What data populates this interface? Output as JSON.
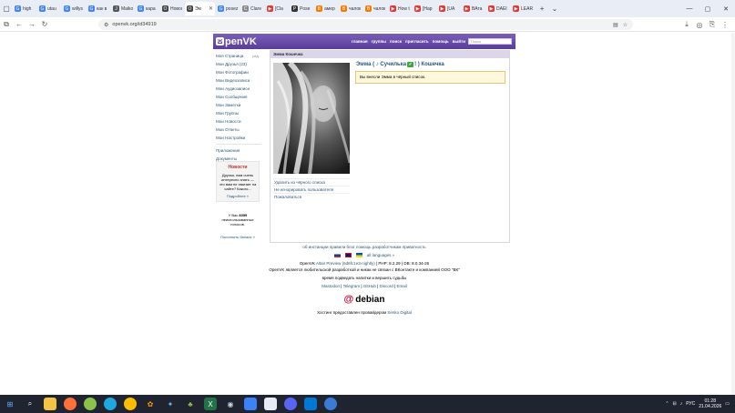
{
  "browser": {
    "tabs": [
      {
        "title": "high",
        "color": "#4285f4",
        "glyph": "G"
      },
      {
        "title": "utau",
        "color": "#4285f4",
        "glyph": "G"
      },
      {
        "title": "willys",
        "color": "#4285f4",
        "glyph": "G"
      },
      {
        "title": "как в",
        "color": "#4285f4",
        "glyph": "G"
      },
      {
        "title": "Maiko",
        "color": "#555555",
        "glyph": "J"
      },
      {
        "title": "кара",
        "color": "#4285f4",
        "glyph": "G"
      },
      {
        "title": "Новос",
        "color": "#444444",
        "glyph": "O"
      },
      {
        "title": "Эм",
        "color": "#444444",
        "glyph": "O",
        "active": true
      },
      {
        "title": "posez",
        "color": "#4285f4",
        "glyph": "G"
      },
      {
        "title": "Clare",
        "color": "#888888",
        "glyph": "C"
      },
      {
        "title": "[Cla",
        "color": "#e53935",
        "glyph": "▶"
      },
      {
        "title": "Pose",
        "color": "#333333",
        "glyph": "P"
      },
      {
        "title": "амер",
        "color": "#f57c00",
        "glyph": "B"
      },
      {
        "title": "чалов",
        "color": "#f57c00",
        "glyph": "B"
      },
      {
        "title": "чалов",
        "color": "#f57c00",
        "glyph": "B"
      },
      {
        "title": "How t",
        "color": "#e53935",
        "glyph": "▶"
      },
      {
        "title": "[Нар",
        "color": "#e53935",
        "glyph": "▶"
      },
      {
        "title": "[UA",
        "color": "#e53935",
        "glyph": "▶"
      },
      {
        "title": "ВАта",
        "color": "#e53935",
        "glyph": "▶"
      },
      {
        "title": "DAEI",
        "color": "#e53935",
        "glyph": "▶"
      },
      {
        "title": "LEAR",
        "color": "#e53935",
        "glyph": "▶"
      }
    ],
    "url": "openvk.org/id34919"
  },
  "ovk": {
    "logo": "penVK",
    "nav": [
      "главная",
      "группы",
      "поиск",
      "пригласить",
      "помощь",
      "выйти"
    ],
    "search_placeholder": "Поиск",
    "sidebar": [
      {
        "label": "Моя Страница",
        "edit": "ред."
      },
      {
        "label": "Мои Друзья (23)"
      },
      {
        "label": "Мои Фотографии"
      },
      {
        "label": "Мои Видеозаписи"
      },
      {
        "label": "Мои Аудиозаписи"
      },
      {
        "label": "Мои Сообщения"
      },
      {
        "label": "Мои Заметки"
      },
      {
        "label": "Мои Группы"
      },
      {
        "label": "Мои Новости"
      },
      {
        "label": "Мои Ответы"
      },
      {
        "label": "Мои Настройки"
      }
    ],
    "sidebar2": [
      "Приложения",
      "Документы"
    ],
    "news": {
      "title": "Новости",
      "text": "Друзья, нам очень интересно знать — что вам не хватает на сайте? Какого...",
      "more": "Подробнее »"
    },
    "balance": {
      "prefix": "У Вас",
      "amount": "8359",
      "suffix": "неиспользованных голосов.",
      "topup": "Пополнить баланс »"
    },
    "profile": {
      "header": "Эмма Кошечка",
      "name": "Эмма ( ♪ Сучилька",
      "name_check": "✓",
      "name_tail": "! ) Кошечка",
      "note": "Вы внесли Эмма в чёрный список.",
      "links": [
        "Удалить из чёрного списка",
        "Не игнорировать пользователя",
        "Пожаловаться"
      ]
    },
    "footer": {
      "links": [
        "об инстанции",
        "правила",
        "блог",
        "помощь",
        "разработчикам",
        "приватность"
      ],
      "all_languages": "all languages »",
      "version_prefix": "OpenVK",
      "version_link": "Altair Preview (6d6fc1e3-nightly)",
      "version_suffix": "| PHP: 8.2.29 | DB: 8.0.34-26",
      "disclaimer": "OpenVK является любительской разработкой и никак не связан с ВКонтакте и компанией ООО \"ВК\"",
      "motto": "время подведать напитки и вершить судьбы",
      "socials": [
        "Mastodon",
        "Telegram",
        "GitHub",
        "Discord",
        "Email"
      ],
      "debian": "debian",
      "hosting_prefix": "Хостинг предоставлен провайдером",
      "hosting_link": "Senko Digital"
    }
  },
  "taskbar": {
    "lang": "РУС",
    "time": "01:28",
    "date": "21.04.2026"
  }
}
